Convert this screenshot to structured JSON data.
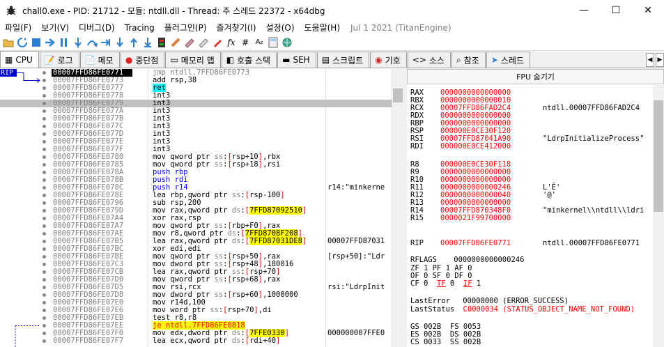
{
  "window": {
    "title": "chall0.exe - PID: 21712 - 모듈: ntdll.dll - Thread: 주 스레드 22372 - x64dbg",
    "minimize": "—",
    "maximize": "☐",
    "close": "✕"
  },
  "menu": {
    "items": [
      "파일(F)",
      "보기(V)",
      "디버그(D)",
      "Tracing",
      "플러그인(P)",
      "즐겨찾기(I)",
      "설정(O)",
      "도움말(H)"
    ],
    "version": "Jul 1 2021 (TitanEngine)"
  },
  "tabs": [
    {
      "label": "CPU",
      "icon": "cpu-icon",
      "glyph": "▦"
    },
    {
      "label": "로그",
      "icon": "log-icon",
      "glyph": "📝"
    },
    {
      "label": "메모",
      "icon": "notes-icon",
      "glyph": "📄"
    },
    {
      "label": "중단점",
      "icon": "breakpoint-icon",
      "glyph": "●"
    },
    {
      "label": "메모리 맵",
      "icon": "memory-map-icon",
      "glyph": "▭"
    },
    {
      "label": "호출 스택",
      "icon": "call-stack-icon",
      "glyph": "◧"
    },
    {
      "label": "SEH",
      "icon": "seh-icon",
      "glyph": "▬"
    },
    {
      "label": "스크립트",
      "icon": "script-icon",
      "glyph": "▤"
    },
    {
      "label": "기호",
      "icon": "symbols-icon",
      "glyph": "◉"
    },
    {
      "label": "소스",
      "icon": "source-icon",
      "glyph": "<>"
    },
    {
      "label": "참조",
      "icon": "references-icon",
      "glyph": "⌕"
    },
    {
      "label": "스레드",
      "icon": "threads-icon",
      "glyph": "➤"
    }
  ],
  "disasm": {
    "rip_label": "RIP",
    "rows": [
      {
        "addr": "00007FFD86FE0771",
        "ins": "<span class='kw-jmp'>jmp ntdll.7FFD86FE0773</span>",
        "cmt": ""
      },
      {
        "addr": "00007FFD86FE0773",
        "ins": "add rsp,38",
        "cmt": ""
      },
      {
        "addr": "00007FFD86FE0777",
        "ins": "<span class='kw-ret'>ret</span>",
        "cmt": ""
      },
      {
        "addr": "00007FFD86FE0778",
        "ins": "int3",
        "cmt": ""
      },
      {
        "addr": "00007FFD86FE0779",
        "ins": "int3",
        "cmt": ""
      },
      {
        "addr": "00007FFD86FE077A",
        "ins": "int3",
        "cmt": ""
      },
      {
        "addr": "00007FFD86FE077B",
        "ins": "int3",
        "cmt": ""
      },
      {
        "addr": "00007FFD86FE077C",
        "ins": "int3",
        "cmt": ""
      },
      {
        "addr": "00007FFD86FE077D",
        "ins": "int3",
        "cmt": ""
      },
      {
        "addr": "00007FFD86FE077E",
        "ins": "int3",
        "cmt": ""
      },
      {
        "addr": "00007FFD86FE077F",
        "ins": "int3",
        "cmt": ""
      },
      {
        "addr": "00007FFD86FE0780",
        "ins": "mov qword ptr <span class='seg'>ss</span>:[rsp+10],rbx",
        "cmt": ""
      },
      {
        "addr": "00007FFD86FE0785",
        "ins": "mov qword ptr <span class='seg'>ss</span>:[rsp+18],rsi",
        "cmt": ""
      },
      {
        "addr": "00007FFD86FE078A",
        "ins": "<span class='kw-push'>push rbp</span>",
        "cmt": ""
      },
      {
        "addr": "00007FFD86FE078B",
        "ins": "<span class='kw-push'>push rdi</span>",
        "cmt": ""
      },
      {
        "addr": "00007FFD86FE078C",
        "ins": "<span class='kw-push'>push r14</span>",
        "cmt": "r14:\"minkerne"
      },
      {
        "addr": "00007FFD86FE078E",
        "ins": "lea rbp,qword ptr <span class='seg'>ss</span>:[rsp-100]",
        "cmt": ""
      },
      {
        "addr": "00007FFD86FE0796",
        "ins": "sub rsp,200",
        "cmt": ""
      },
      {
        "addr": "00007FFD86FE079D",
        "ins": "mov rax,qword ptr <span class='seg'>ds</span>:[<span class='hl'>7FFD87092510</span>]",
        "cmt": ""
      },
      {
        "addr": "00007FFD86FE07A4",
        "ins": "xor rax,rsp",
        "cmt": ""
      },
      {
        "addr": "00007FFD86FE07A7",
        "ins": "mov qword ptr <span class='seg'>ss</span>:[rbp+F0],rax",
        "cmt": ""
      },
      {
        "addr": "00007FFD86FE07AE",
        "ins": "mov r8,qword ptr <span class='seg'>ds</span>:[<span class='hl'>7FFD8708F208</span>]",
        "cmt": ""
      },
      {
        "addr": "00007FFD86FE07B5",
        "ins": "lea rax,qword ptr <span class='seg'>ds</span>:[<span class='hl'>7FFD87031DE8</span>]",
        "cmt": "00007FFD87031"
      },
      {
        "addr": "00007FFD86FE07BC",
        "ins": "xor edi,edi",
        "cmt": ""
      },
      {
        "addr": "00007FFD86FE07BE",
        "ins": "mov qword ptr <span class='seg'>ss</span>:[rsp+50],rax",
        "cmt": "[rsp+50]:\"Ldr"
      },
      {
        "addr": "00007FFD86FE07C3",
        "ins": "mov dword ptr <span class='seg'>ss</span>:[rsp+48],180016",
        "cmt": ""
      },
      {
        "addr": "00007FFD86FE07CB",
        "ins": "lea rax,qword ptr <span class='seg'>ss</span>:[rsp+70]",
        "cmt": ""
      },
      {
        "addr": "00007FFD86FE07D0",
        "ins": "mov qword ptr <span class='seg'>ss</span>:[rsp+68],rax",
        "cmt": ""
      },
      {
        "addr": "00007FFD86FE07D5",
        "ins": "mov rsi,rcx",
        "cmt": "rsi:\"LdrpInit"
      },
      {
        "addr": "00007FFD86FE07D8",
        "ins": "mov dword ptr <span class='seg'>ss</span>:[rsp+60],1000000",
        "cmt": ""
      },
      {
        "addr": "00007FFD86FE07E0",
        "ins": "mov r14d,100",
        "cmt": ""
      },
      {
        "addr": "00007FFD86FE07E6",
        "ins": "mov word ptr <span class='seg'>ss</span>:[rsp+70],di",
        "cmt": ""
      },
      {
        "addr": "00007FFD86FE07EB",
        "ins": "test r8,r8",
        "cmt": ""
      },
      {
        "addr": "00007FFD86FE07EE",
        "ins": "<span class='kw-je'>je ntdll.7FFD86FE0818</span>",
        "cmt": ""
      },
      {
        "addr": "00007FFD86FE07F0",
        "ins": "mov edx,dword ptr <span class='seg'>ds</span>:[<span class='hl'>7FFE0330</span>]",
        "cmt": "000000007FFE0"
      },
      {
        "addr": "00007FFD86FE07F7",
        "ins": "lea ecx,qword ptr <span class='seg'>ds</span>:[rdi+40]",
        "cmt": ""
      }
    ]
  },
  "fpu": {
    "header": "FPU 숨기기",
    "registers": [
      {
        "name": "RAX",
        "value": "0000000000000000",
        "comment": ""
      },
      {
        "name": "RBX",
        "value": "0000000000000010",
        "comment": ""
      },
      {
        "name": "RCX",
        "value": "00007FFD86FAD2C4",
        "comment": "ntdll.00007FFD86FAD2C4"
      },
      {
        "name": "RDX",
        "value": "0000000000000000",
        "comment": ""
      },
      {
        "name": "RBP",
        "value": "0000000000000000",
        "comment": ""
      },
      {
        "name": "RSP",
        "value": "000000E0CE30F120",
        "comment": ""
      },
      {
        "name": "RSI",
        "value": "00007FFD87041A90",
        "comment": "\"LdrpInitializeProcess\""
      },
      {
        "name": "RDI",
        "value": "000000E0CE412000",
        "comment": ""
      },
      {
        "name": "R8",
        "value": "000000E0CE30F118",
        "comment": ""
      },
      {
        "name": "R9",
        "value": "0000000000000000",
        "comment": ""
      },
      {
        "name": "R10",
        "value": "0000000000000000",
        "comment": ""
      },
      {
        "name": "R11",
        "value": "0000000000000246",
        "comment": "L'Ȇ'"
      },
      {
        "name": "R12",
        "value": "0000000000000040",
        "comment": "'@'"
      },
      {
        "name": "R13",
        "value": "0000000000000000",
        "comment": ""
      },
      {
        "name": "R14",
        "value": "00007FFD870348F0",
        "comment": "\"minkernel\\\\ntdll\\\\ldri"
      },
      {
        "name": "R15",
        "value": "0000021F99700000",
        "comment": ""
      },
      {
        "name": "RIP",
        "value": "00007FFD86FE0771",
        "comment": "ntdll.00007FFD86FE0771"
      }
    ],
    "rflags_label": "RFLAGS",
    "rflags_value": "0000000000000246",
    "flags_line1": "ZF 1  PF 1  AF 0",
    "flags_line2": "OF 0  SF 0  DF 0",
    "flags_line3_a": "CF 0  ",
    "flags_line3_b": "TF",
    "flags_line3_c": " 0  ",
    "flags_line3_d": "IF",
    "flags_line3_e": " 1",
    "lasterror_label": "LastError",
    "lasterror_value": "00000000 (ERROR_SUCCESS)",
    "laststatus_label": "LastStatus",
    "laststatus_value": "C0000034 (STATUS_OBJECT_NAME_NOT_FOUND)",
    "seg1": "GS 002B  FS 0053",
    "seg2": "ES 002B  DS 002B",
    "seg3": "CS 0033  SS 002B"
  },
  "toolbar_icons": [
    "open-icon",
    "restart-icon",
    "close-icon",
    "run-icon",
    "pause-icon",
    "step-into-icon",
    "step-over-icon",
    "trace-into-icon",
    "trace-over-icon",
    "execute-till-return-icon",
    "run-to-user-code-icon",
    "scylla-icon",
    "patch-icon",
    "comment-icon",
    "label-icon",
    "bookmark-icon",
    "function-icon",
    "hash-icon",
    "font-icon",
    "calculator-icon",
    "globe-icon"
  ],
  "colors": {
    "addr_gray": "#808080",
    "reg_red": "#ff0000",
    "hl_yellow": "#ffff00",
    "ret_cyan": "#00ffff",
    "rip_blue": "#0000cc"
  }
}
